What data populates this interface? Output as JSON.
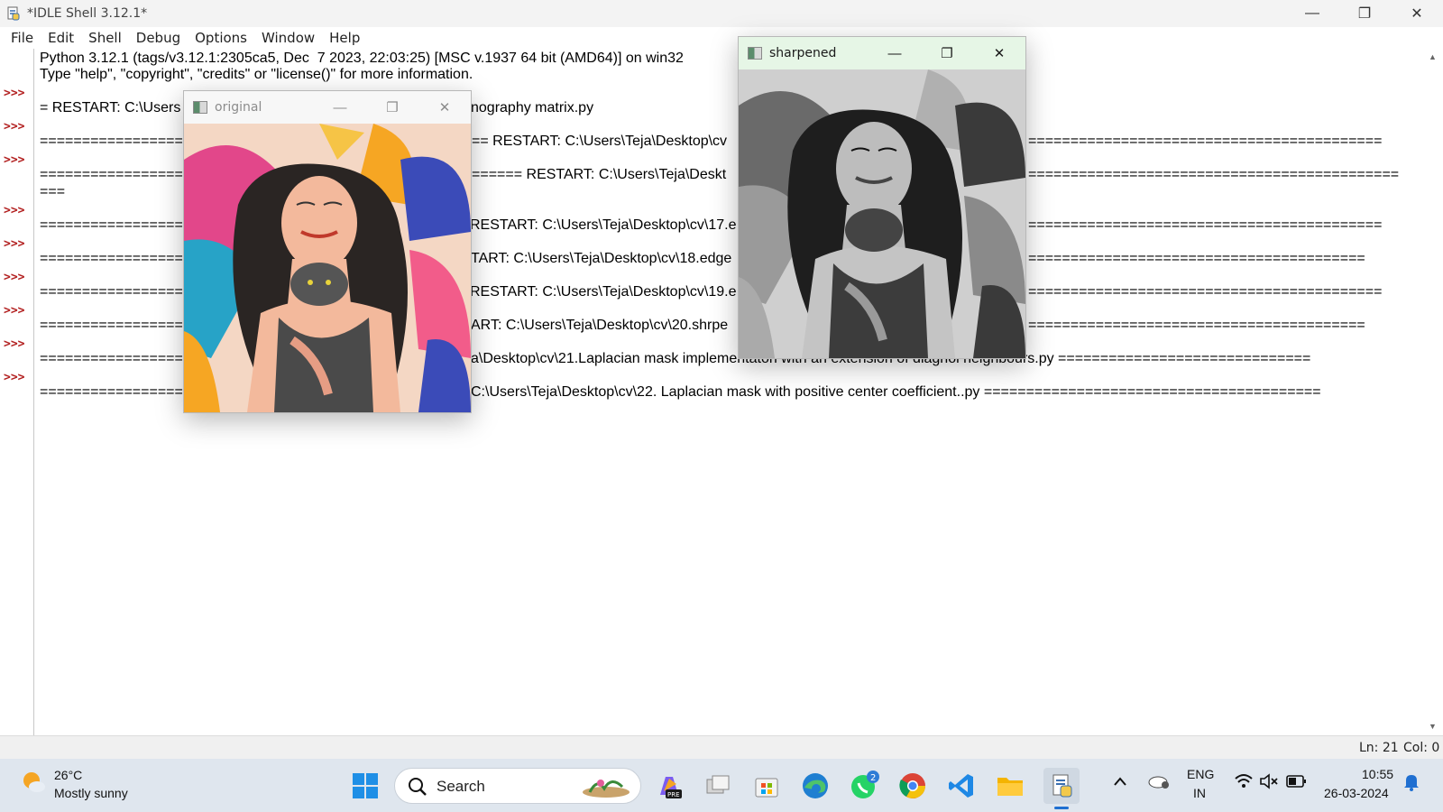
{
  "window": {
    "title": "*IDLE Shell 3.12.1*",
    "min_glyph": "—",
    "max_glyph": "❐",
    "close_glyph": "✕"
  },
  "menu": [
    "File",
    "Edit",
    "Shell",
    "Debug",
    "Options",
    "Window",
    "Help"
  ],
  "shell": {
    "prompt": ">>>",
    "lines": [
      "Python 3.12.1 (tags/v3.12.1:2305ca5, Dec  7 2023, 22:03:25) [MSC v.1937 64 bit (AMD64)] on win32",
      "Type \"help\", \"copyright\", \"credits\" or \"license()\" for more information.",
      "= RESTART: C:\\Users",
      "=================",
      "=================",
      "===",
      "=================",
      "=================",
      "=================",
      "=================",
      "=================",
      "=================",
      "nography matrix.py",
      "== RESTART: C:\\Users\\Teja\\Desktop\\cv",
      "====== RESTART: C:\\Users\\Teja\\Deskt",
      "RESTART: C:\\Users\\Teja\\Desktop\\cv\\17.e",
      "TART: C:\\Users\\Teja\\Desktop\\cv\\18.edge",
      "RESTART: C:\\Users\\Teja\\Desktop\\cv\\19.e",
      "ART: C:\\Users\\Teja\\Desktop\\cv\\20.shrpe",
      "a\\Desktop\\cv\\21.Laplacian mask implementaton with an extension of diagnol neighbours.py ==============================",
      "C:\\Users\\Teja\\Desktop\\cv\\22. Laplacian mask with positive center coefficient..py ========================================",
      "==========================================",
      "============================================",
      "==========================================",
      "========================================",
      "==========================================",
      "========================================"
    ]
  },
  "status": {
    "ln": "Ln: 21",
    "col": "Col: 0"
  },
  "cv_windows": {
    "original": {
      "title": "original"
    },
    "sharpened": {
      "title": "sharpened"
    }
  },
  "taskbar": {
    "weather_temp": "26°C",
    "weather_cond": "Mostly sunny",
    "search_label": "Search",
    "whatsapp_badge": "2",
    "pre_badge": "PRE",
    "lang_top": "ENG",
    "lang_bottom": "IN",
    "time": "10:55",
    "date": "26-03-2024"
  },
  "colors": {
    "prompt": "#b21f1f",
    "taskbar": "#dfe6ee",
    "sharpened_title_bg": "#e6f6e6"
  }
}
